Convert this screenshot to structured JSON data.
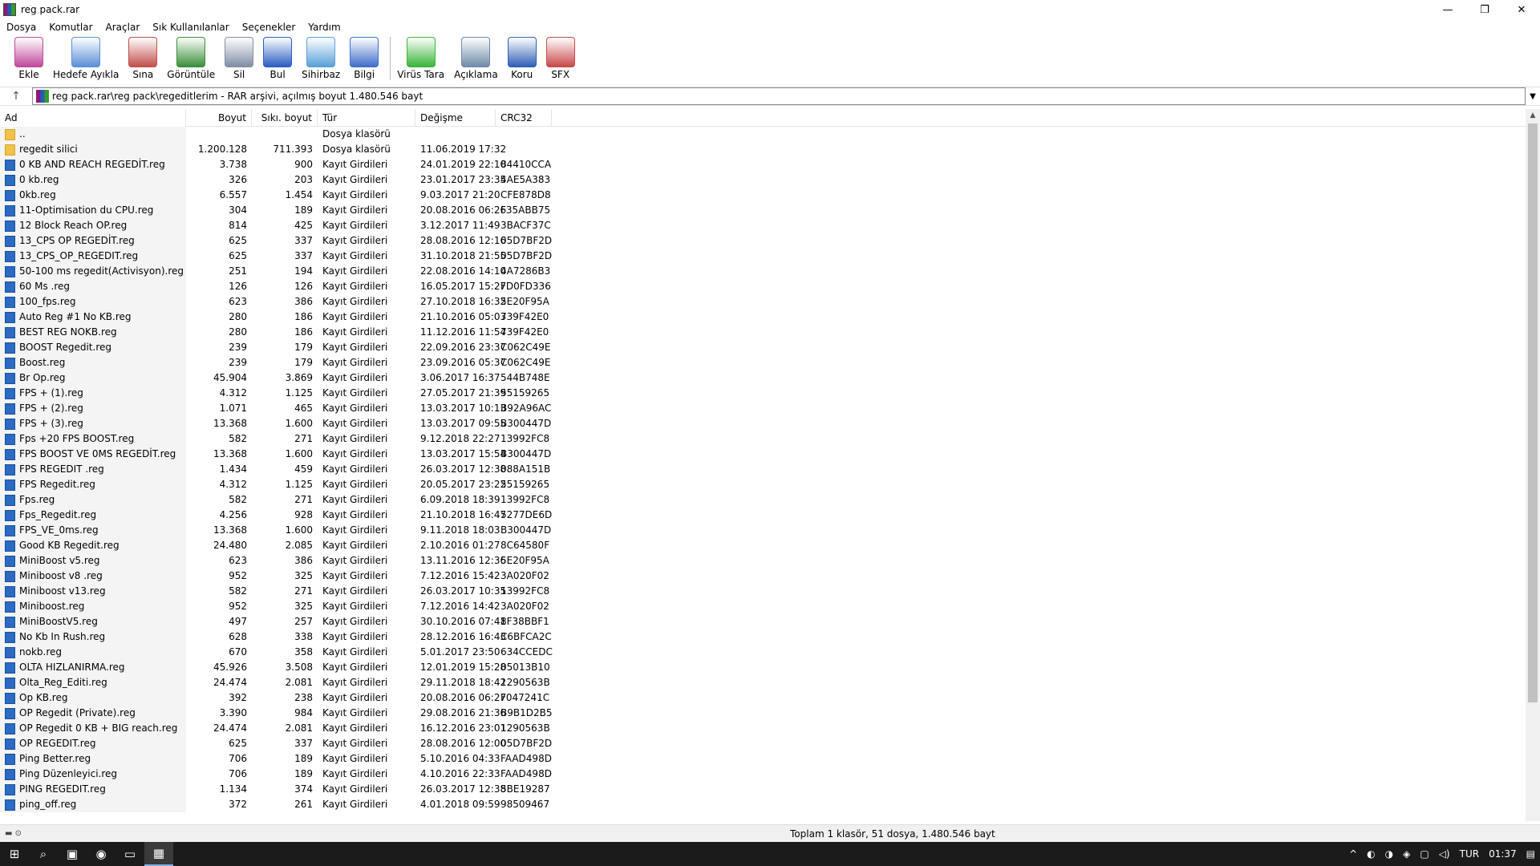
{
  "window": {
    "title": "reg pack.rar",
    "minimize": "—",
    "maximize": "❐",
    "close": "✕"
  },
  "menu": [
    "Dosya",
    "Komutlar",
    "Araçlar",
    "Sık Kullanılanlar",
    "Seçenekler",
    "Yardım"
  ],
  "toolbar": [
    {
      "label": "Ekle",
      "icon": "add-archive-icon",
      "color": "#c04a9a"
    },
    {
      "label": "Hedefe Ayıkla",
      "icon": "extract-folder-icon",
      "color": "#5b8fd6"
    },
    {
      "label": "Sına",
      "icon": "test-clipboard-icon",
      "color": "#c0504d"
    },
    {
      "label": "Görüntüle",
      "icon": "view-book-icon",
      "color": "#3a8f3a"
    },
    {
      "label": "Sil",
      "icon": "delete-trash-icon",
      "color": "#7f8fa6"
    },
    {
      "label": "Bul",
      "icon": "find-magnifier-icon",
      "color": "#2a5fc1"
    },
    {
      "label": "Sihirbaz",
      "icon": "wizard-wand-icon",
      "color": "#5aa0d8"
    },
    {
      "label": "Bilgi",
      "icon": "info-icon",
      "color": "#3f6fc8"
    },
    {
      "label": "Virüs Tara",
      "icon": "virus-scan-icon",
      "color": "#3ab53a"
    },
    {
      "label": "Açıklama",
      "icon": "comment-icon",
      "color": "#6f8aa8"
    },
    {
      "label": "Koru",
      "icon": "protect-shield-icon",
      "color": "#2f5fb5"
    },
    {
      "label": "SFX",
      "icon": "sfx-icon",
      "color": "#c84a4a"
    }
  ],
  "address": {
    "path": "reg pack.rar\\reg pack\\regeditlerim - RAR arşivi, açılmış boyut 1.480.546 bayt"
  },
  "columns": {
    "name": "Ad",
    "size": "Boyut",
    "packed": "Sıkı. boyut",
    "type": "Tür",
    "modified": "Değişme",
    "crc": "CRC32"
  },
  "rows": [
    {
      "name": "..",
      "size": "",
      "packed": "",
      "type": "Dosya klasörü",
      "modified": "",
      "crc": "",
      "kind": "folder"
    },
    {
      "name": "regedit silici",
      "size": "1.200.128",
      "packed": "711.393",
      "type": "Dosya klasörü",
      "modified": "11.06.2019 17:32",
      "crc": "",
      "kind": "folder"
    },
    {
      "name": "0 KB AND REACH REGEDİT.reg",
      "size": "3.738",
      "packed": "900",
      "type": "Kayıt Girdileri",
      "modified": "24.01.2019 22:10",
      "crc": "84410CCA",
      "kind": "reg"
    },
    {
      "name": "0 kb.reg",
      "size": "326",
      "packed": "203",
      "type": "Kayıt Girdileri",
      "modified": "23.01.2017 23:35",
      "crc": "4AE5A383",
      "kind": "reg"
    },
    {
      "name": "0kb.reg",
      "size": "6.557",
      "packed": "1.454",
      "type": "Kayıt Girdileri",
      "modified": "9.03.2017 21:20",
      "crc": "CFE878D8",
      "kind": "reg"
    },
    {
      "name": "11-Optimisation du CPU.reg",
      "size": "304",
      "packed": "189",
      "type": "Kayıt Girdileri",
      "modified": "20.08.2016 06:26",
      "crc": "F35ABB75",
      "kind": "reg"
    },
    {
      "name": "12 Block Reach OP.reg",
      "size": "814",
      "packed": "425",
      "type": "Kayıt Girdileri",
      "modified": "3.12.2017 11:49",
      "crc": "3BACF37C",
      "kind": "reg"
    },
    {
      "name": "13_CPS OP REGEDİT.reg",
      "size": "625",
      "packed": "337",
      "type": "Kayıt Girdileri",
      "modified": "28.08.2016 12:16",
      "crc": "05D7BF2D",
      "kind": "reg"
    },
    {
      "name": "13_CPS_OP_REGEDIT.reg",
      "size": "625",
      "packed": "337",
      "type": "Kayıt Girdileri",
      "modified": "31.10.2018 21:55",
      "crc": "05D7BF2D",
      "kind": "reg"
    },
    {
      "name": "50-100 ms regedit(Activisyon).reg",
      "size": "251",
      "packed": "194",
      "type": "Kayıt Girdileri",
      "modified": "22.08.2016 14:10",
      "crc": "4A7286B3",
      "kind": "reg"
    },
    {
      "name": "60 Ms .reg",
      "size": "126",
      "packed": "126",
      "type": "Kayıt Girdileri",
      "modified": "16.05.2017 15:27",
      "crc": "FD0FD336",
      "kind": "reg"
    },
    {
      "name": "100_fps.reg",
      "size": "623",
      "packed": "386",
      "type": "Kayıt Girdileri",
      "modified": "27.10.2018 16:32",
      "crc": "5E20F95A",
      "kind": "reg"
    },
    {
      "name": "Auto Reg #1 No KB.reg",
      "size": "280",
      "packed": "186",
      "type": "Kayıt Girdileri",
      "modified": "21.10.2016 05:03",
      "crc": "739F42E0",
      "kind": "reg"
    },
    {
      "name": "BEST REG NOKB.reg",
      "size": "280",
      "packed": "186",
      "type": "Kayıt Girdileri",
      "modified": "11.12.2016 11:54",
      "crc": "739F42E0",
      "kind": "reg"
    },
    {
      "name": "BOOST Regedit.reg",
      "size": "239",
      "packed": "179",
      "type": "Kayıt Girdileri",
      "modified": "22.09.2016 23:37",
      "crc": "C062C49E",
      "kind": "reg"
    },
    {
      "name": "Boost.reg",
      "size": "239",
      "packed": "179",
      "type": "Kayıt Girdileri",
      "modified": "23.09.2016 05:37",
      "crc": "C062C49E",
      "kind": "reg"
    },
    {
      "name": "Br Op.reg",
      "size": "45.904",
      "packed": "3.869",
      "type": "Kayıt Girdileri",
      "modified": "3.06.2017 16:37",
      "crc": "544B748E",
      "kind": "reg"
    },
    {
      "name": "FPS + (1).reg",
      "size": "4.312",
      "packed": "1.125",
      "type": "Kayıt Girdileri",
      "modified": "27.05.2017 21:39",
      "crc": "55159265",
      "kind": "reg"
    },
    {
      "name": "FPS + (2).reg",
      "size": "1.071",
      "packed": "465",
      "type": "Kayıt Girdileri",
      "modified": "13.03.2017 10:13",
      "crc": "B92A96AC",
      "kind": "reg"
    },
    {
      "name": "FPS + (3).reg",
      "size": "13.368",
      "packed": "1.600",
      "type": "Kayıt Girdileri",
      "modified": "13.03.2017 09:55",
      "crc": "B300447D",
      "kind": "reg"
    },
    {
      "name": "Fps +20 FPS BOOST.reg",
      "size": "582",
      "packed": "271",
      "type": "Kayıt Girdileri",
      "modified": "9.12.2018 22:27",
      "crc": "13992FC8",
      "kind": "reg"
    },
    {
      "name": "FPS BOOST VE 0MS REGEDİT.reg",
      "size": "13.368",
      "packed": "1.600",
      "type": "Kayıt Girdileri",
      "modified": "13.03.2017 15:54",
      "crc": "B300447D",
      "kind": "reg"
    },
    {
      "name": "FPS REGEDIT .reg",
      "size": "1.434",
      "packed": "459",
      "type": "Kayıt Girdileri",
      "modified": "26.03.2017 12:38",
      "crc": "088A151B",
      "kind": "reg"
    },
    {
      "name": "FPS Regedit.reg",
      "size": "4.312",
      "packed": "1.125",
      "type": "Kayıt Girdileri",
      "modified": "20.05.2017 23:22",
      "crc": "55159265",
      "kind": "reg"
    },
    {
      "name": "Fps.reg",
      "size": "582",
      "packed": "271",
      "type": "Kayıt Girdileri",
      "modified": "6.09.2018 18:39",
      "crc": "13992FC8",
      "kind": "reg"
    },
    {
      "name": "Fps_Regedit.reg",
      "size": "4.256",
      "packed": "928",
      "type": "Kayıt Girdileri",
      "modified": "21.10.2018 16:47",
      "crc": "5277DE6D",
      "kind": "reg"
    },
    {
      "name": "FPS_VE_0ms.reg",
      "size": "13.368",
      "packed": "1.600",
      "type": "Kayıt Girdileri",
      "modified": "9.11.2018 18:03",
      "crc": "B300447D",
      "kind": "reg"
    },
    {
      "name": "Good KB Regedit.reg",
      "size": "24.480",
      "packed": "2.085",
      "type": "Kayıt Girdileri",
      "modified": "2.10.2016 01:27",
      "crc": "8C64580F",
      "kind": "reg"
    },
    {
      "name": "MiniBoost v5.reg",
      "size": "623",
      "packed": "386",
      "type": "Kayıt Girdileri",
      "modified": "13.11.2016 12:36",
      "crc": "5E20F95A",
      "kind": "reg"
    },
    {
      "name": "Miniboost v8 .reg",
      "size": "952",
      "packed": "325",
      "type": "Kayıt Girdileri",
      "modified": "7.12.2016 15:42",
      "crc": "3A020F02",
      "kind": "reg"
    },
    {
      "name": "Miniboost v13.reg",
      "size": "582",
      "packed": "271",
      "type": "Kayıt Girdileri",
      "modified": "26.03.2017 10:35",
      "crc": "13992FC8",
      "kind": "reg"
    },
    {
      "name": "Miniboost.reg",
      "size": "952",
      "packed": "325",
      "type": "Kayıt Girdileri",
      "modified": "7.12.2016 14:42",
      "crc": "3A020F02",
      "kind": "reg"
    },
    {
      "name": "MiniBoostV5.reg",
      "size": "497",
      "packed": "257",
      "type": "Kayıt Girdileri",
      "modified": "30.10.2016 07:41",
      "crc": "8F38BBF1",
      "kind": "reg"
    },
    {
      "name": "No Kb In Rush.reg",
      "size": "628",
      "packed": "338",
      "type": "Kayıt Girdileri",
      "modified": "28.12.2016 16:43",
      "crc": "C6BFCA2C",
      "kind": "reg"
    },
    {
      "name": "nokb.reg",
      "size": "670",
      "packed": "358",
      "type": "Kayıt Girdileri",
      "modified": "5.01.2017 23:50",
      "crc": "634CCEDC",
      "kind": "reg"
    },
    {
      "name": "OLTA HIZLANIRMA.reg",
      "size": "45.926",
      "packed": "3.508",
      "type": "Kayıt Girdileri",
      "modified": "12.01.2019 15:28",
      "crc": "05013B10",
      "kind": "reg"
    },
    {
      "name": "Olta_Reg_Editi.reg",
      "size": "24.474",
      "packed": "2.081",
      "type": "Kayıt Girdileri",
      "modified": "29.11.2018 18:42",
      "crc": "1290563B",
      "kind": "reg"
    },
    {
      "name": "Op KB.reg",
      "size": "392",
      "packed": "238",
      "type": "Kayıt Girdileri",
      "modified": "20.08.2016 06:27",
      "crc": "F047241C",
      "kind": "reg"
    },
    {
      "name": "OP Regedit (Private).reg",
      "size": "3.390",
      "packed": "984",
      "type": "Kayıt Girdileri",
      "modified": "29.08.2016 21:36",
      "crc": "B9B1D2B5",
      "kind": "reg"
    },
    {
      "name": "OP Regedit 0 KB + BIG reach.reg",
      "size": "24.474",
      "packed": "2.081",
      "type": "Kayıt Girdileri",
      "modified": "16.12.2016 23:01",
      "crc": "1290563B",
      "kind": "reg"
    },
    {
      "name": "OP REGEDIT.reg",
      "size": "625",
      "packed": "337",
      "type": "Kayıt Girdileri",
      "modified": "28.08.2016 12:00",
      "crc": "05D7BF2D",
      "kind": "reg"
    },
    {
      "name": "Ping Better.reg",
      "size": "706",
      "packed": "189",
      "type": "Kayıt Girdileri",
      "modified": "5.10.2016 04:33",
      "crc": "FAAD498D",
      "kind": "reg"
    },
    {
      "name": "Ping Düzenleyici.reg",
      "size": "706",
      "packed": "189",
      "type": "Kayıt Girdileri",
      "modified": "4.10.2016 22:33",
      "crc": "FAAD498D",
      "kind": "reg"
    },
    {
      "name": "PING REGEDIT.reg",
      "size": "1.134",
      "packed": "374",
      "type": "Kayıt Girdileri",
      "modified": "26.03.2017 12:38",
      "crc": "5BE19287",
      "kind": "reg"
    },
    {
      "name": "ping_off.reg",
      "size": "372",
      "packed": "261",
      "type": "Kayıt Girdileri",
      "modified": "4.01.2018 09:59",
      "crc": "98509467",
      "kind": "reg"
    }
  ],
  "status": {
    "text": "Toplam 1 klasör, 51 dosya, 1.480.546 bayt"
  },
  "taskbar": {
    "language": "TUR",
    "time": "01:37"
  }
}
